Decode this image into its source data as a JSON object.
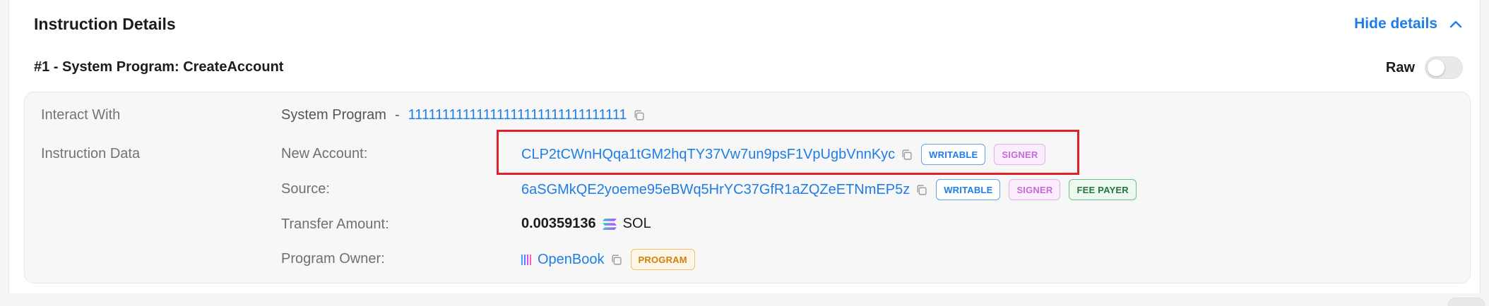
{
  "card": {
    "title": "Instruction Details",
    "hide_details_label": "Hide details"
  },
  "instruction": {
    "title": "#1 - System Program: CreateAccount",
    "raw_label": "Raw",
    "raw_enabled": false
  },
  "interact_with": {
    "label": "Interact With",
    "program_name": "System Program",
    "separator": "-",
    "program_address": "11111111111111111111111111111111"
  },
  "instruction_data": {
    "label": "Instruction Data",
    "new_account": {
      "label": "New Account:",
      "address": "CLP2tCWnHQqa1tGM2hqTY37Vw7un9psF1VpUgbVnnKyc",
      "badges": [
        "WRITABLE",
        "SIGNER"
      ]
    },
    "source": {
      "label": "Source:",
      "address": "6aSGMkQE2yoeme95eBWq5HrYC37GfR1aZQZeETNmEP5z",
      "badges": [
        "WRITABLE",
        "SIGNER",
        "FEE PAYER"
      ]
    },
    "transfer_amount": {
      "label": "Transfer Amount:",
      "amount": "0.00359136",
      "token_icon": "solana-icon",
      "token": "SOL"
    },
    "program_owner": {
      "label": "Program Owner:",
      "icon": "openbook-icon",
      "name": "OpenBook",
      "badge": "PROGRAM"
    }
  },
  "colors": {
    "accent": "#1f7de6",
    "highlight": "#e0202a",
    "signer": "#c86ad9",
    "fee_payer": "#25753e",
    "program": "#d0800d"
  }
}
